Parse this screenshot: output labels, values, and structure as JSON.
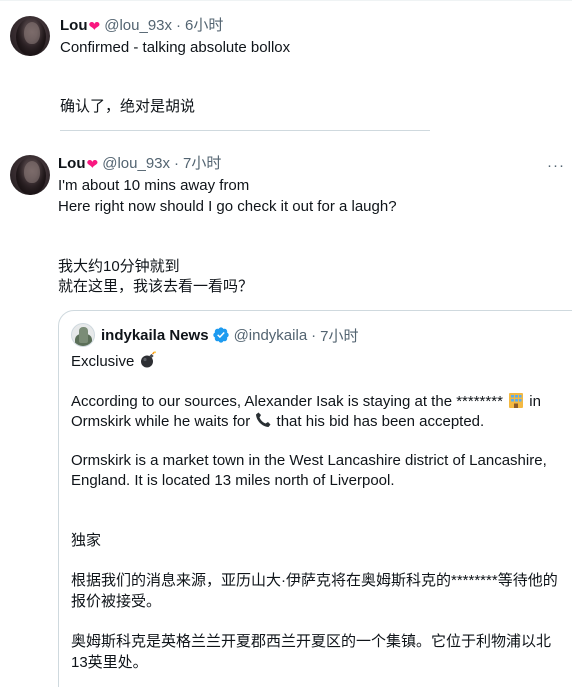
{
  "tweets": [
    {
      "name": "Lou",
      "heart": "❤",
      "handle": "@lou_93x",
      "separator": "·",
      "time": "6小时",
      "text": [
        "Confirmed - talking absolute bollox"
      ],
      "translation": [
        "确认了，绝对是胡说"
      ]
    },
    {
      "name": "Lou",
      "heart": "❤",
      "handle": "@lou_93x",
      "separator": "·",
      "time": "7小时",
      "text": [
        "I'm about 10 mins away from",
        "Here right now should I go check it out for a laugh?"
      ],
      "translation": [
        "我大约10分钟就到",
        "就在这里，我该去看一看吗？"
      ],
      "more": "···"
    }
  ],
  "quoted": {
    "name": "indykaila News",
    "handle": "@indykaila",
    "separator": "·",
    "time": "7小时",
    "line1": "Exclusive",
    "line2_pre": "According to our sources, Alexander Isak is staying at the ********",
    "line2_post": "in",
    "line3_pre": "Ormskirk while he waits for",
    "line3_post": "that his bid has been accepted.",
    "line4": "Ormskirk is a market town in the West Lancashire district of Lancashire,",
    "line5": "England. It is located 13 miles north of Liverpool.",
    "zh1": "独家",
    "zh2": "根据我们的消息来源，亚历山大·伊萨克将在奥姆斯科克的********等待他的",
    "zh3": "报价被接受。",
    "zh4": "奥姆斯科克是英格兰兰开夏郡西兰开夏区的一个集镇。它位于利物浦以北",
    "zh5": "13英里处。"
  },
  "colors": {
    "text": "#0f1419",
    "secondary": "#536471",
    "heart": "#f91880",
    "verified": "#1d9bf0",
    "border": "#cfd9de"
  }
}
